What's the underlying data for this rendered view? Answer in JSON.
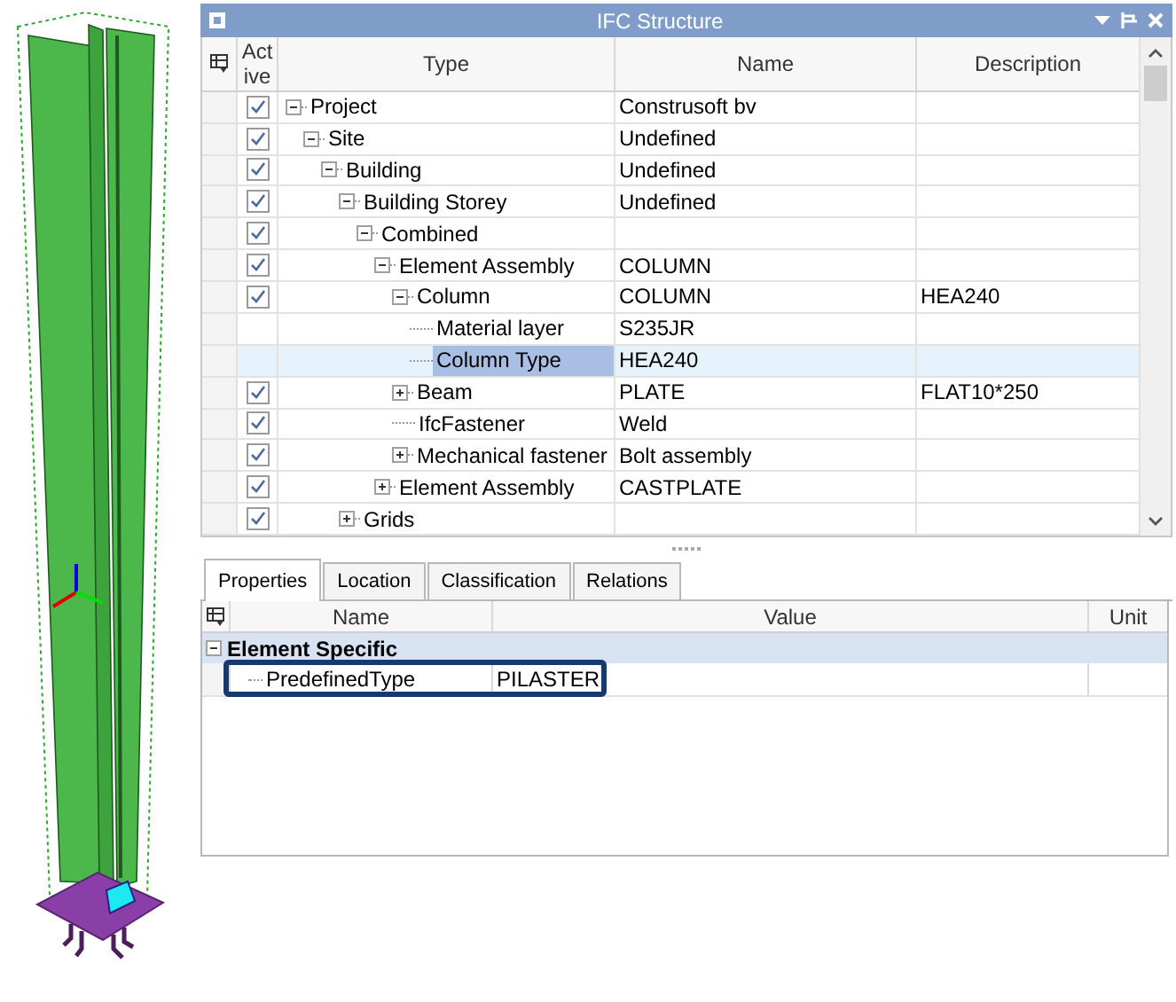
{
  "panel": {
    "title": "IFC Structure"
  },
  "columns": [
    "Active",
    "Type",
    "Name",
    "Description"
  ],
  "tree": [
    {
      "type": "Project",
      "name": "Construsoft bv",
      "active": true,
      "selected": false,
      "expanded": true,
      "children": [
        {
          "type": "Site",
          "name": "Undefined",
          "active": true,
          "selected": false,
          "expanded": true,
          "children": [
            {
              "type": "Building",
              "name": "Undefined",
              "active": true,
              "selected": false,
              "expanded": true,
              "children": [
                {
                  "type": "Building Storey",
                  "name": "Undefined",
                  "active": true,
                  "selected": false,
                  "expanded": true,
                  "children": [
                    {
                      "type": "Combined",
                      "active": true,
                      "selected": false,
                      "expanded": true,
                      "children": [
                        {
                          "type": "Element Assembly",
                          "name": "COLUMN",
                          "active": true,
                          "selected": false,
                          "expanded": true,
                          "children": [
                            {
                              "type": "Column",
                              "name": "COLUMN",
                              "description": "HEA240",
                              "active": true,
                              "selected": false,
                              "expanded": true,
                              "children": [
                                {
                                  "type": "Material layer",
                                  "name": "S235JR",
                                  "selected": false
                                },
                                {
                                  "type": "Column Type",
                                  "name": "HEA240",
                                  "selected": true
                                }
                              ]
                            },
                            {
                              "type": "Beam",
                              "name": "PLATE",
                              "description": "FLAT10*250",
                              "active": true,
                              "selected": false,
                              "expanded": false
                            },
                            {
                              "type": "IfcFastener",
                              "name": "Weld",
                              "active": true,
                              "selected": false
                            },
                            {
                              "type": "Mechanical fastener",
                              "name": "Bolt assembly",
                              "active": true,
                              "selected": false,
                              "expanded": false
                            }
                          ]
                        },
                        {
                          "type": "Element Assembly",
                          "name": "CASTPLATE",
                          "active": true,
                          "selected": false,
                          "expanded": false
                        }
                      ]
                    }
                  ]
                },
                {
                  "type": "Grids",
                  "active": true,
                  "selected": false,
                  "expanded": false
                }
              ]
            }
          ]
        }
      ]
    }
  ],
  "tabs": [
    {
      "label": "Properties",
      "selected": true
    },
    {
      "label": "Location",
      "selected": false
    },
    {
      "label": "Classification",
      "selected": false
    },
    {
      "label": "Relations",
      "selected": false
    }
  ],
  "properties": {
    "columns": [
      "Name",
      "Value",
      "Unit"
    ],
    "groups": [
      {
        "title": "Element Specific",
        "expanded": true,
        "rows": [
          {
            "name": "PredefinedType",
            "value": "PILASTER",
            "highlighted": true
          }
        ]
      }
    ]
  }
}
